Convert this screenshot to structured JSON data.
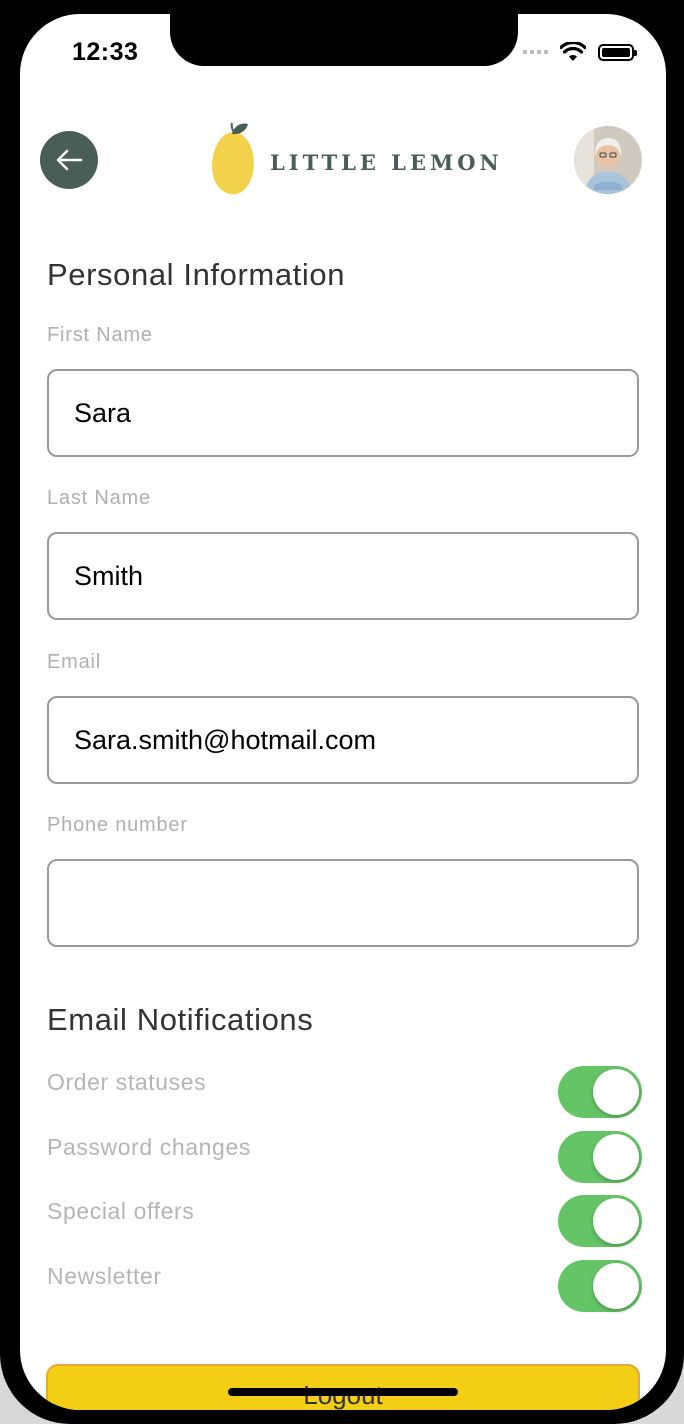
{
  "status_bar": {
    "time": "12:33"
  },
  "header": {
    "back_icon": "arrow-left-icon",
    "logo_text": "LITTLE LEMON",
    "avatar_icon": "profile-photo"
  },
  "personal_info": {
    "title": "Personal Information",
    "first_name": {
      "label": "First Name",
      "value": "Sara"
    },
    "last_name": {
      "label": "Last Name",
      "value": "Smith"
    },
    "email": {
      "label": "Email",
      "value": "Sara.smith@hotmail.com"
    },
    "phone": {
      "label": "Phone number",
      "value": ""
    }
  },
  "notifications": {
    "title": "Email Notifications",
    "items": [
      {
        "label": "Order statuses",
        "enabled": true
      },
      {
        "label": "Password changes",
        "enabled": true
      },
      {
        "label": "Special offers",
        "enabled": true
      },
      {
        "label": "Newsletter",
        "enabled": true
      }
    ]
  },
  "logout_label": "Logout",
  "colors": {
    "primary": "#495e57",
    "accent": "#f4ce14",
    "toggle_on": "#65c466"
  }
}
